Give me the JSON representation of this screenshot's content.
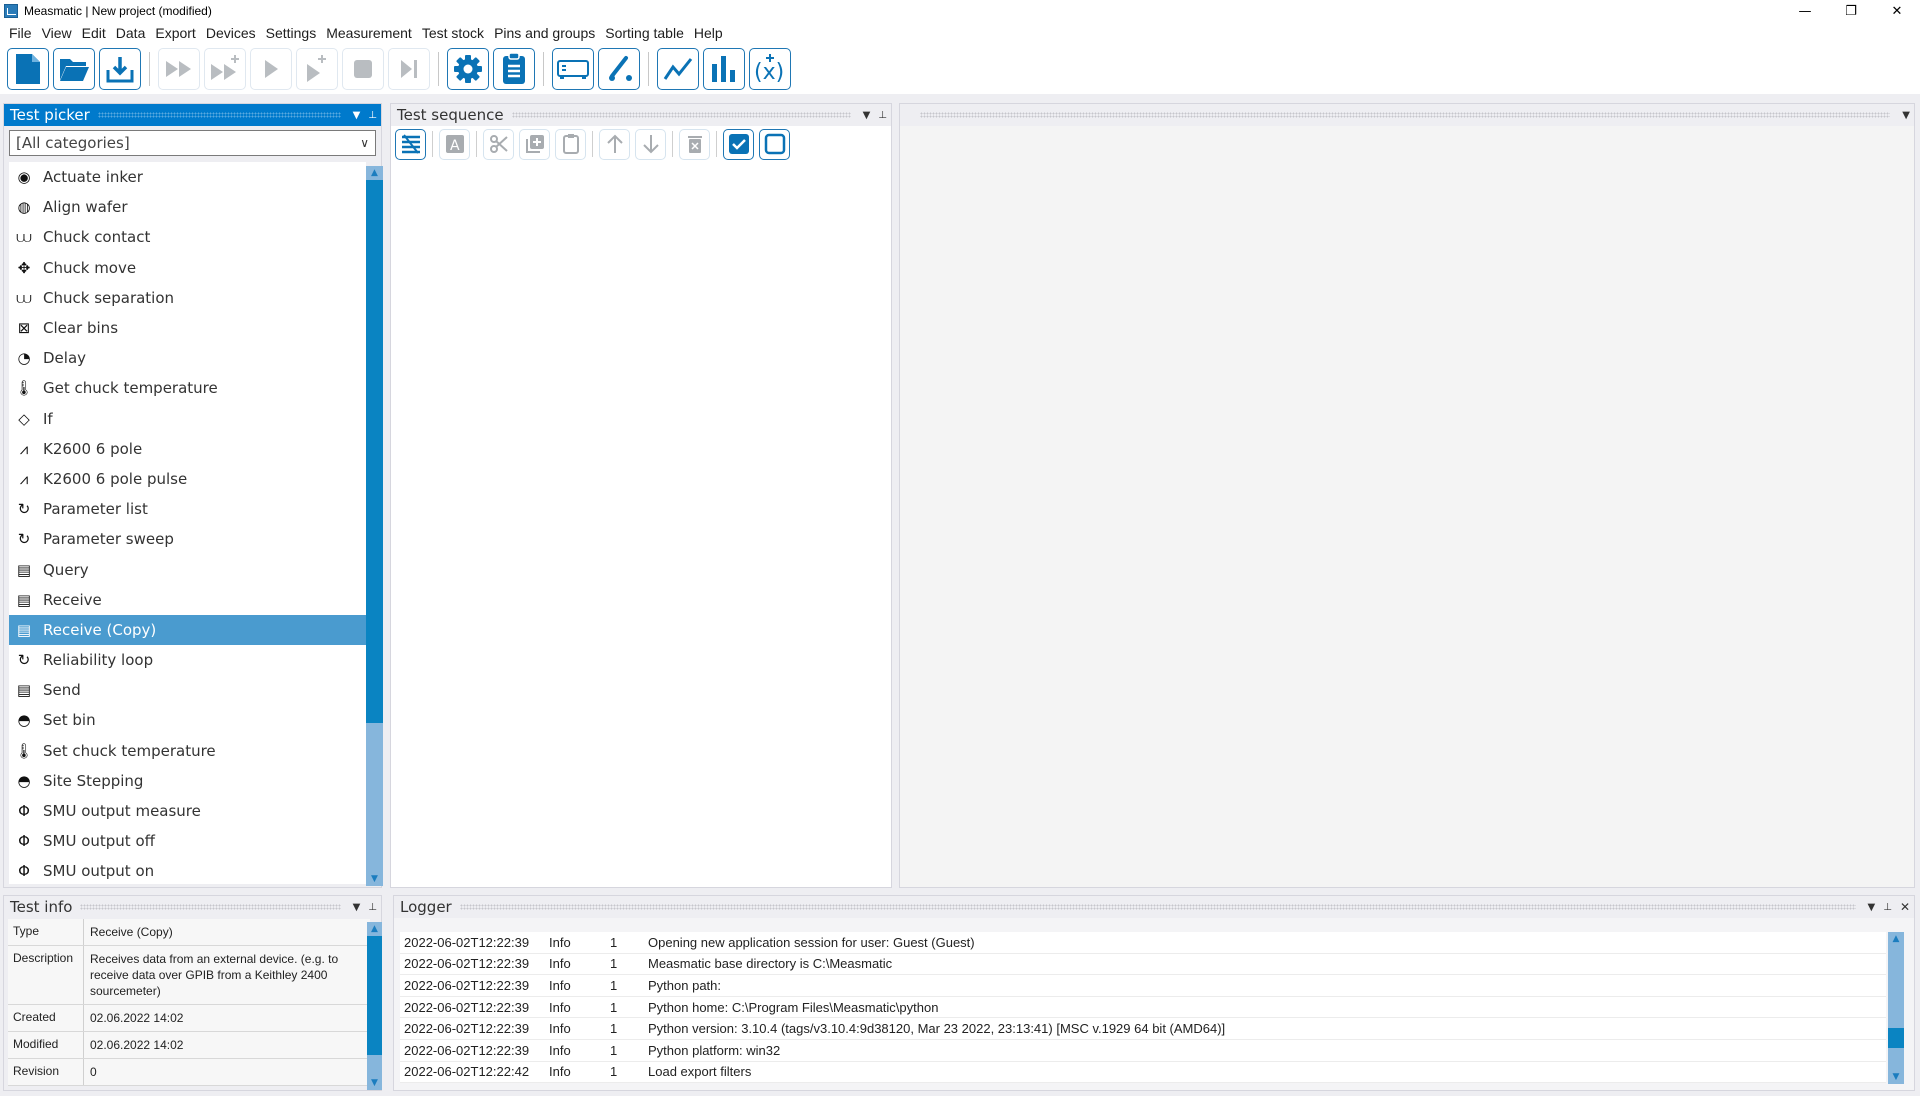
{
  "window": {
    "title": "Measmatic | New project (modified)",
    "controls": {
      "minimize": "—",
      "restore": "❐",
      "close": "✕"
    }
  },
  "menu": [
    "File",
    "View",
    "Edit",
    "Data",
    "Export",
    "Devices",
    "Settings",
    "Measurement",
    "Test stock",
    "Pins and groups",
    "Sorting table",
    "Help"
  ],
  "toolbar": {
    "buttons": [
      {
        "icon": "new-file-icon",
        "state": "enabled"
      },
      {
        "icon": "open-folder-icon",
        "state": "enabled"
      },
      {
        "icon": "save-download-icon",
        "state": "enabled"
      },
      {
        "icon": "run-all-icon",
        "state": "disabled"
      },
      {
        "icon": "run-all-plus-icon",
        "state": "disabled"
      },
      {
        "icon": "run-icon",
        "state": "disabled"
      },
      {
        "icon": "run-plus-icon",
        "state": "disabled"
      },
      {
        "icon": "stop-icon",
        "state": "disabled"
      },
      {
        "icon": "step-icon",
        "state": "disabled"
      },
      {
        "icon": "settings-gear-icon",
        "state": "enabled"
      },
      {
        "icon": "clipboard-icon",
        "state": "enabled"
      },
      {
        "icon": "device-icon",
        "state": "enabled"
      },
      {
        "icon": "probe-icon",
        "state": "enabled"
      },
      {
        "icon": "line-chart-icon",
        "state": "enabled"
      },
      {
        "icon": "bar-chart-icon",
        "state": "enabled"
      },
      {
        "icon": "formula-icon",
        "state": "enabled"
      }
    ]
  },
  "test_picker": {
    "title": "Test picker",
    "category": "[All categories]",
    "selected": "Receive (Copy)",
    "items": [
      {
        "label": "Actuate inker",
        "icon": "wafer-inker-icon"
      },
      {
        "label": "Align wafer",
        "icon": "wafer-align-icon"
      },
      {
        "label": "Chuck contact",
        "icon": "chuck-contact-icon"
      },
      {
        "label": "Chuck move",
        "icon": "chuck-move-icon"
      },
      {
        "label": "Chuck separation",
        "icon": "chuck-separation-icon"
      },
      {
        "label": "Clear bins",
        "icon": "clear-bins-icon"
      },
      {
        "label": "Delay",
        "icon": "clock-icon"
      },
      {
        "label": "Get chuck temperature",
        "icon": "thermometer-icon"
      },
      {
        "label": "If",
        "icon": "condition-icon"
      },
      {
        "label": "K2600 6 pole",
        "icon": "pulse-chart-icon"
      },
      {
        "label": "K2600 6 pole pulse",
        "icon": "pulse-chart-icon"
      },
      {
        "label": "Parameter list",
        "icon": "loop-icon"
      },
      {
        "label": "Parameter sweep",
        "icon": "loop-icon"
      },
      {
        "label": "Query",
        "icon": "instrument-query-icon"
      },
      {
        "label": "Receive",
        "icon": "instrument-receive-icon"
      },
      {
        "label": "Receive (Copy)",
        "icon": "instrument-receive-icon"
      },
      {
        "label": "Reliability loop",
        "icon": "loop-icon"
      },
      {
        "label": "Send",
        "icon": "instrument-send-icon"
      },
      {
        "label": "Set bin",
        "icon": "set-bin-icon"
      },
      {
        "label": "Set chuck temperature",
        "icon": "thermometer-icon"
      },
      {
        "label": "Site Stepping",
        "icon": "site-stepping-icon"
      },
      {
        "label": "SMU output measure",
        "icon": "smu-icon"
      },
      {
        "label": "SMU output off",
        "icon": "smu-icon"
      },
      {
        "label": "SMU output on",
        "icon": "smu-icon"
      }
    ]
  },
  "test_sequence": {
    "title": "Test sequence",
    "tools": [
      "collapse-list-icon",
      "rename-icon",
      "cut-icon",
      "duplicate-icon",
      "paste-icon",
      "move-up-icon",
      "move-down-icon",
      "delete-icon",
      "check-all-icon",
      "uncheck-all-icon"
    ]
  },
  "test_info": {
    "title": "Test info",
    "rows": [
      {
        "key": "Type",
        "value": "Receive (Copy)"
      },
      {
        "key": "Description",
        "value": "Receives data from an external device. (e.g. to receive data over GPIB from a Keithley 2400 sourcemeter)"
      },
      {
        "key": "Created",
        "value": "02.06.2022 14:02"
      },
      {
        "key": "Modified",
        "value": "02.06.2022 14:02"
      },
      {
        "key": "Revision",
        "value": "0"
      }
    ]
  },
  "logger": {
    "title": "Logger",
    "rows": [
      {
        "time": "2022-06-02T12:22:39",
        "level": "Info",
        "thread": "1",
        "message": "Opening new application session for user: Guest (Guest)"
      },
      {
        "time": "2022-06-02T12:22:39",
        "level": "Info",
        "thread": "1",
        "message": "Measmatic base directory is C:\\Measmatic"
      },
      {
        "time": "2022-06-02T12:22:39",
        "level": "Info",
        "thread": "1",
        "message": "Python path:"
      },
      {
        "time": "2022-06-02T12:22:39",
        "level": "Info",
        "thread": "1",
        "message": "Python home: C:\\Program Files\\Measmatic\\python"
      },
      {
        "time": "2022-06-02T12:22:39",
        "level": "Info",
        "thread": "1",
        "message": "Python version: 3.10.4 (tags/v3.10.4:9d38120, Mar 23 2022, 23:13:41) [MSC v.1929 64 bit (AMD64)]"
      },
      {
        "time": "2022-06-02T12:22:39",
        "level": "Info",
        "thread": "1",
        "message": "Python platform: win32"
      },
      {
        "time": "2022-06-02T12:22:42",
        "level": "Info",
        "thread": "1",
        "message": "Load export filters"
      }
    ]
  },
  "colors": {
    "accent": "#007acc",
    "icon_blue": "#0a72b5",
    "selection": "#4a9bcf",
    "scroll_thumb": "#0a84c2",
    "scroll_track": "#86b6dc",
    "disabled_icon": "#b9bdc1"
  }
}
